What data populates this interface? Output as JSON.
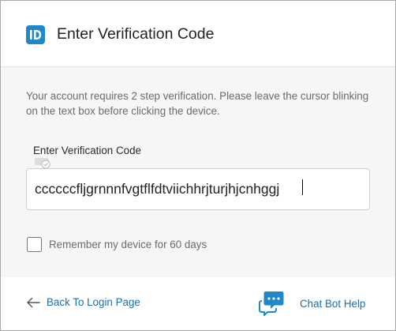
{
  "header": {
    "logo_icon": "id-badge-icon",
    "logo_text": "ID",
    "brand_color": "#1e88c8",
    "title": "Enter Verification Code"
  },
  "main": {
    "description": "Your account requires 2 step verification. Please leave the cursor blinking on the text box before clicking the device.",
    "code_field": {
      "label": "Enter Verification Code",
      "value": "ccccccfljgrnnnfvgtflfdtviichhrjturjhjcnhggj",
      "overlay_icon": "autofill-key-icon"
    },
    "remember": {
      "label": "Remember my device for 60 days",
      "checked": false
    }
  },
  "footer": {
    "back_icon": "arrow-left-icon",
    "back_label": "Back To Login Page",
    "chat_icon": "chat-bubble-icon",
    "chat_label": "Chat Bot Help",
    "link_color": "#1a6fb0"
  }
}
